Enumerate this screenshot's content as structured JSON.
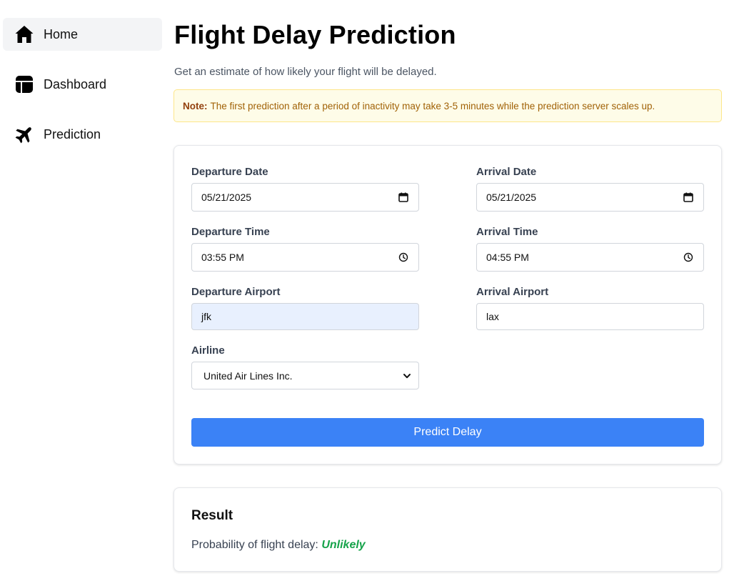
{
  "sidebar": {
    "items": [
      {
        "label": "Home",
        "icon": "home-icon",
        "active": true
      },
      {
        "label": "Dashboard",
        "icon": "dashboard-icon",
        "active": false
      },
      {
        "label": "Prediction",
        "icon": "airplane-icon",
        "active": false
      }
    ]
  },
  "header": {
    "title": "Flight Delay Prediction",
    "subtitle": "Get an estimate of how likely your flight will be delayed."
  },
  "note": {
    "label": "Note:",
    "text": "The first prediction after a period of inactivity may take 3-5 minutes while the prediction server scales up."
  },
  "form": {
    "departure_date": {
      "label": "Departure Date",
      "value": "05/21/2025",
      "icon": "calendar-icon"
    },
    "arrival_date": {
      "label": "Arrival Date",
      "value": "05/21/2025",
      "icon": "calendar-icon"
    },
    "departure_time": {
      "label": "Departure Time",
      "value": "03:55 PM",
      "icon": "clock-icon"
    },
    "arrival_time": {
      "label": "Arrival Time",
      "value": "04:55 PM",
      "icon": "clock-icon"
    },
    "departure_airport": {
      "label": "Departure Airport",
      "value": "jfk"
    },
    "arrival_airport": {
      "label": "Arrival Airport",
      "value": "lax"
    },
    "airline": {
      "label": "Airline",
      "value": "United Air Lines Inc.",
      "icon": "chevron-down-icon"
    },
    "submit_label": "Predict Delay"
  },
  "result": {
    "title": "Result",
    "prefix": "Probability of flight delay:",
    "value": "Unlikely"
  },
  "colors": {
    "primary_button": "#3b82f6",
    "note_background": "#fefce8",
    "note_text": "#a16207",
    "result_value": "#16a34a"
  }
}
